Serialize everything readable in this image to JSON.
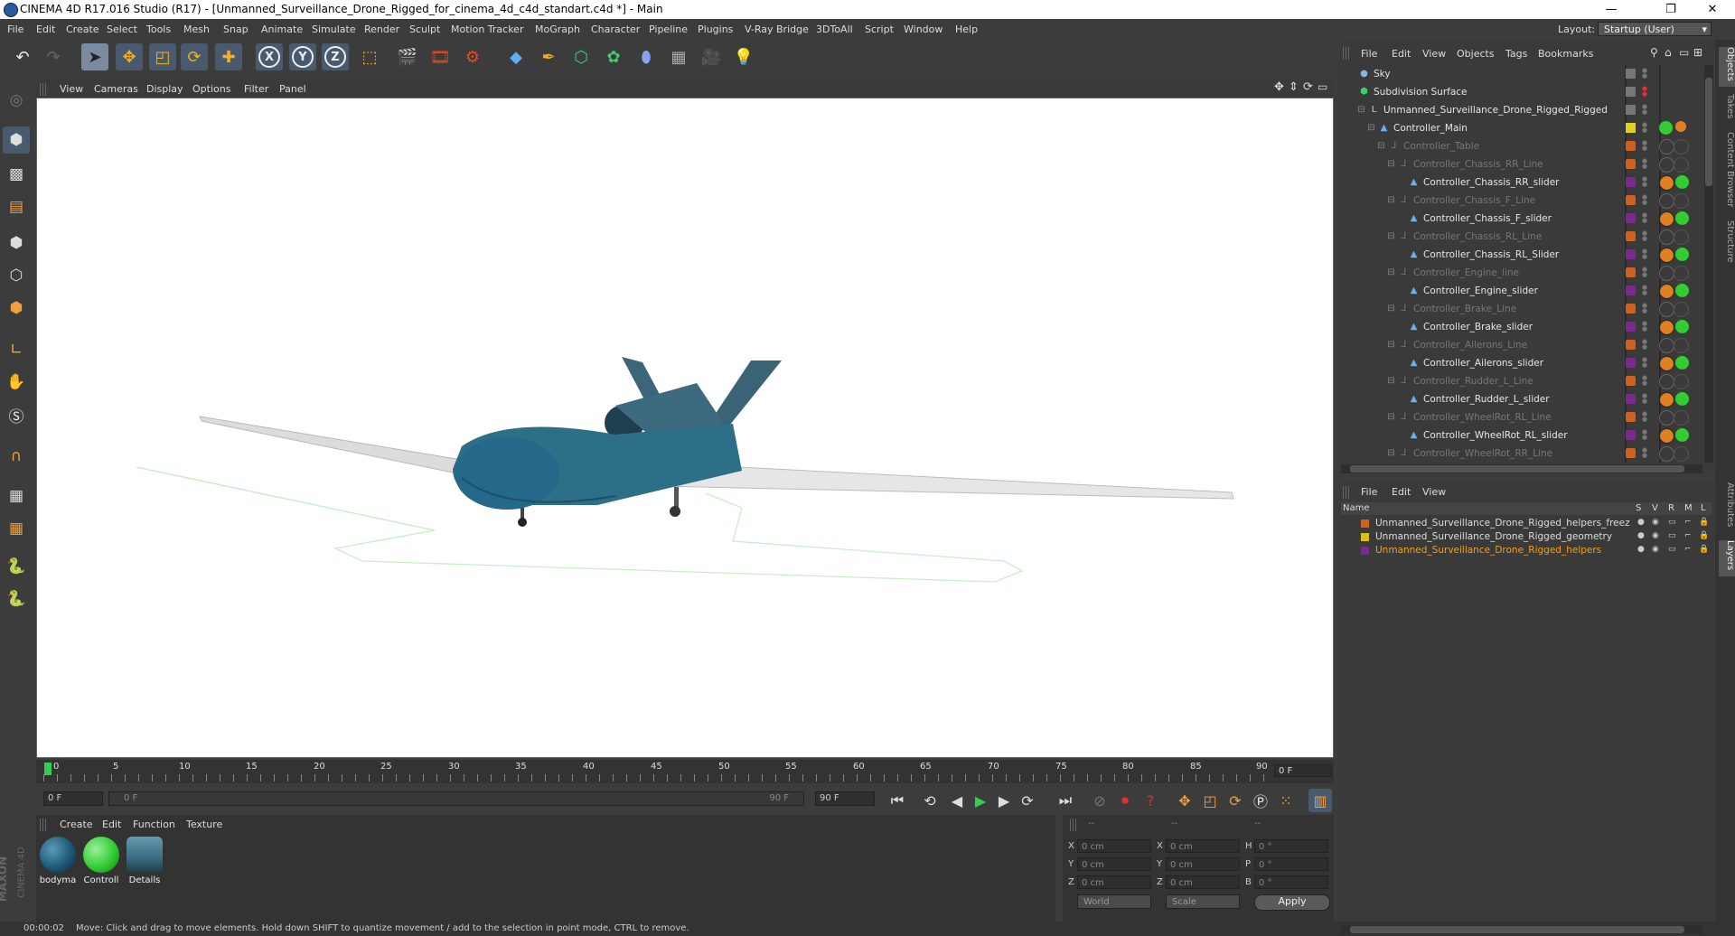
{
  "window": {
    "title": "CINEMA 4D R17.016 Studio (R17) - [Unmanned_Surveillance_Drone_Rigged_for_cinema_4d_c4d_standart.c4d *] - Main",
    "minimize": "—",
    "maximize": "❐",
    "close": "✕"
  },
  "menubar": {
    "items": [
      "File",
      "Edit",
      "Create",
      "Select",
      "Tools",
      "Mesh",
      "Snap",
      "Animate",
      "Simulate",
      "Render",
      "Sculpt",
      "Motion Tracker",
      "MoGraph",
      "Character",
      "Pipeline",
      "Plugins",
      "V-Ray Bridge",
      "3DToAll",
      "Script",
      "Window",
      "Help"
    ],
    "layout_label": "Layout:",
    "layout_value": "Startup (User)"
  },
  "toolbar": {
    "icons": [
      "undo-icon",
      "redo-icon",
      "select-arrow-icon",
      "move-icon",
      "scale-icon",
      "rotate-icon",
      "add-object-icon",
      "x-axis-icon",
      "y-axis-icon",
      "z-axis-icon",
      "coordinate-system-icon",
      "render-view-icon",
      "render-picture-icon",
      "render-settings-icon",
      "cube-icon",
      "pen-spline-icon",
      "subdivision-icon",
      "array-icon",
      "deformer-icon",
      "floor-icon",
      "camera-icon",
      "light-icon"
    ],
    "axis_labels": [
      "X",
      "Y",
      "Z"
    ]
  },
  "left_toolbar": {
    "icons": [
      "make-editable-icon",
      "model-mode-icon",
      "texture-mode-icon",
      "workplane-icon",
      "points-mode-icon",
      "edges-mode-icon",
      "polygons-mode-icon",
      "axis-mode-icon",
      "tweak-mode-icon",
      "solo-icon",
      "magnet-icon",
      "snap-grid-icon",
      "snap-settings-icon",
      "python-icon",
      "python-script-icon"
    ]
  },
  "viewport": {
    "menu": [
      "View",
      "Cameras",
      "Display",
      "Options",
      "Filter",
      "Panel"
    ]
  },
  "timeline": {
    "ticks": [
      "0",
      "5",
      "10",
      "15",
      "20",
      "25",
      "30",
      "35",
      "40",
      "45",
      "50",
      "55",
      "60",
      "65",
      "70",
      "75",
      "80",
      "85",
      "90"
    ],
    "current_frame": "0 F",
    "start_field": "0 F",
    "range_start": "0 F",
    "range_end": "90 F",
    "end_field": "90 F"
  },
  "material_manager": {
    "menu": [
      "Create",
      "Edit",
      "Function",
      "Texture"
    ],
    "materials": [
      {
        "name": "bodyma",
        "color": "#1e5a78"
      },
      {
        "name": "Controll",
        "color": "#33cc33"
      },
      {
        "name": "Details",
        "color": "#3a6a80"
      }
    ]
  },
  "coordinates": {
    "header": [
      "--",
      "--",
      "--"
    ],
    "rows": [
      {
        "a": "X",
        "av": "0 cm",
        "b": "X",
        "bv": "0 cm",
        "c": "H",
        "cv": "0 °"
      },
      {
        "a": "Y",
        "av": "0 cm",
        "b": "Y",
        "bv": "0 cm",
        "c": "P",
        "cv": "0 °"
      },
      {
        "a": "Z",
        "av": "0 cm",
        "b": "Z",
        "bv": "0 cm",
        "c": "B",
        "cv": "0 °"
      }
    ],
    "mode": "World",
    "scale": "Scale",
    "apply": "Apply"
  },
  "status": {
    "time": "00:00:02",
    "message": "Move: Click and drag to move elements. Hold down SHIFT to quantize movement / add to the selection in point mode, CTRL to remove."
  },
  "object_manager": {
    "menu": [
      "File",
      "Edit",
      "View",
      "Objects",
      "Tags",
      "Bookmarks"
    ],
    "objects": [
      {
        "name": "Sky",
        "indent": 0,
        "dim": false,
        "icon": "sky-icon",
        "tag": "none"
      },
      {
        "name": "Subdivision Surface",
        "indent": 0,
        "dim": false,
        "icon": "subdivision-icon",
        "tag": "none"
      },
      {
        "name": "Unmanned_Surveillance_Drone_Rigged_Rigged",
        "indent": 1,
        "dim": false,
        "icon": "null-icon",
        "tag": "none"
      },
      {
        "name": "Controller_Main",
        "indent": 2,
        "dim": false,
        "icon": "controller-icon",
        "tag": "main"
      },
      {
        "name": "Controller_Table",
        "indent": 3,
        "dim": true,
        "icon": "spline-icon",
        "tag": "lock"
      },
      {
        "name": "Controller_Chassis_RR_Line",
        "indent": 4,
        "dim": true,
        "icon": "spline-icon",
        "tag": "lock"
      },
      {
        "name": "Controller_Chassis_RR_slider",
        "indent": 5,
        "dim": false,
        "icon": "controller-icon",
        "tag": "green"
      },
      {
        "name": "Controller_Chassis_F_Line",
        "indent": 4,
        "dim": true,
        "icon": "spline-icon",
        "tag": "lock"
      },
      {
        "name": "Controller_Chassis_F_slider",
        "indent": 5,
        "dim": false,
        "icon": "controller-icon",
        "tag": "green"
      },
      {
        "name": "Controller_Chassis_RL_Line",
        "indent": 4,
        "dim": true,
        "icon": "spline-icon",
        "tag": "lock"
      },
      {
        "name": "Controller_Chassis_RL_Slider",
        "indent": 5,
        "dim": false,
        "icon": "controller-icon",
        "tag": "green"
      },
      {
        "name": "Controller_Engine_line",
        "indent": 4,
        "dim": true,
        "icon": "spline-icon",
        "tag": "lock"
      },
      {
        "name": "Controller_Engine_slider",
        "indent": 5,
        "dim": false,
        "icon": "controller-icon",
        "tag": "green"
      },
      {
        "name": "Controller_Brake_Line",
        "indent": 4,
        "dim": true,
        "icon": "spline-icon",
        "tag": "lock"
      },
      {
        "name": "Controller_Brake_slider",
        "indent": 5,
        "dim": false,
        "icon": "controller-icon",
        "tag": "green"
      },
      {
        "name": "Controller_Ailerons_Line",
        "indent": 4,
        "dim": true,
        "icon": "spline-icon",
        "tag": "lock"
      },
      {
        "name": "Controller_Ailerons_slider",
        "indent": 5,
        "dim": false,
        "icon": "controller-icon",
        "tag": "green"
      },
      {
        "name": "Controller_Rudder_L_Line",
        "indent": 4,
        "dim": true,
        "icon": "spline-icon",
        "tag": "lock"
      },
      {
        "name": "Controller_Rudder_L_slider",
        "indent": 5,
        "dim": false,
        "icon": "controller-icon",
        "tag": "green"
      },
      {
        "name": "Controller_WheelRot_RL_Line",
        "indent": 4,
        "dim": true,
        "icon": "spline-icon",
        "tag": "lock"
      },
      {
        "name": "Controller_WheelRot_RL_slider",
        "indent": 5,
        "dim": false,
        "icon": "controller-icon",
        "tag": "green"
      },
      {
        "name": "Controller_WheelRot_RR_Line",
        "indent": 4,
        "dim": true,
        "icon": "spline-icon",
        "tag": "lock"
      }
    ]
  },
  "layer_manager": {
    "menu": [
      "File",
      "Edit",
      "View"
    ],
    "columns": {
      "name": "Name",
      "s": "S",
      "v": "V",
      "r": "R",
      "m": "M",
      "l": "L"
    },
    "layers": [
      {
        "name": "Unmanned_Surveillance_Drone_Rigged_helpers_freez",
        "color": "#d0601a",
        "text_color": "#dddddd"
      },
      {
        "name": "Unmanned_Surveillance_Drone_Rigged_geometry",
        "color": "#d8c21a",
        "text_color": "#dddddd"
      },
      {
        "name": "Unmanned_Surveillance_Drone_Rigged_helpers",
        "color": "#7a2a8a",
        "text_color": "#f0a020"
      }
    ]
  },
  "right_tabs": [
    "Objects",
    "Takes",
    "Content Browser",
    "Structure",
    "Attributes",
    "Layers"
  ],
  "brand": {
    "maxon": "MAXON",
    "product": "CINEMA 4D"
  }
}
